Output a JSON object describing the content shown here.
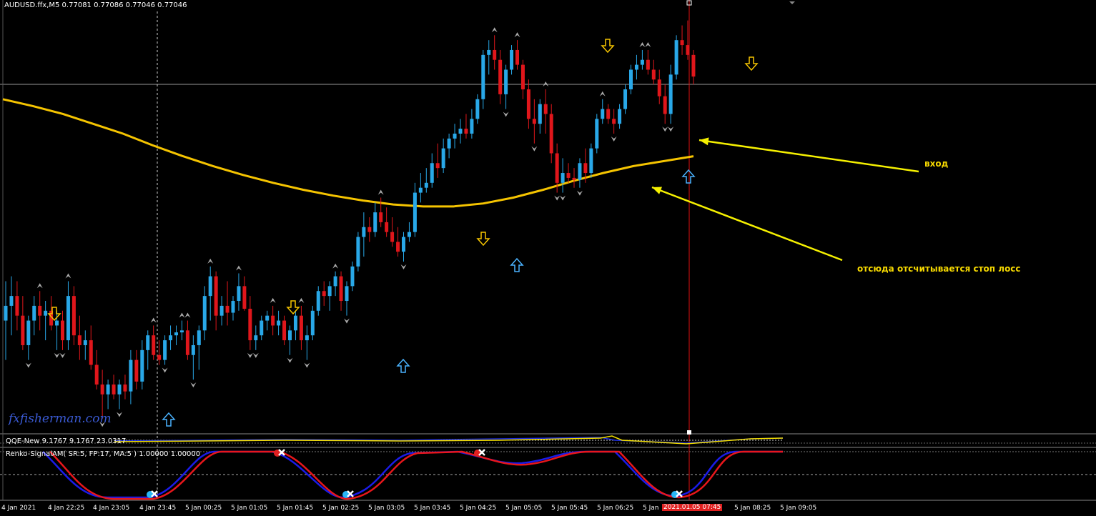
{
  "header": {
    "symbol_line": "AUDUSD.ffx,M5  0.77081 0.77086 0.77046 0.77046"
  },
  "indicators": {
    "qqe_label": "QQE-New 9.1767 9.1767 23.0317",
    "renko_label": "Renko-SignalAM( SR:5, FP:17, MA:5 ) 1.00000 1.00000"
  },
  "watermark": "fxfisherman.com",
  "annotations": {
    "entry": "вход",
    "stop_loss": "отсюда отсчитывается стоп лосс"
  },
  "colors": {
    "bull": "#29a8e8",
    "bear": "#e0161b",
    "ma": "#f5c400",
    "arrow_up": "#4ab3ff",
    "arrow_down": "#f5c400",
    "annotation": "#f5f000",
    "renko_blue": "#1b1be8",
    "renko_red": "#e8161b",
    "crosshair": "#e01010"
  },
  "time_axis": {
    "ticks": [
      "4 Jan 2021",
      "4 Jan 22:25",
      "4 Jan 23:05",
      "4 Jan 23:45",
      "5 Jan 00:25",
      "5 Jan 01:05",
      "5 Jan 01:45",
      "5 Jan 02:25",
      "5 Jan 03:05",
      "5 Jan 03:45",
      "5 Jan 04:25",
      "5 Jan 05:05",
      "5 Jan 05:45",
      "5 Jan 06:25",
      "5 Jan",
      "5 Jan 08:25",
      "5 Jan 09:05"
    ],
    "cursor_label": "2021.01.05 07:45"
  },
  "chart_data": {
    "type": "candlestick",
    "symbol": "AUDUSD.ffx",
    "timeframe": "M5",
    "candles": [
      {
        "o": 0.7695,
        "h": 0.7699,
        "l": 0.7691,
        "c": 0.76965
      },
      {
        "o": 0.76965,
        "h": 0.76995,
        "l": 0.76935,
        "c": 0.76975
      },
      {
        "o": 0.76975,
        "h": 0.7699,
        "l": 0.7694,
        "c": 0.76955
      },
      {
        "o": 0.76955,
        "h": 0.76975,
        "l": 0.7692,
        "c": 0.76925
      },
      {
        "o": 0.76925,
        "h": 0.76955,
        "l": 0.7691,
        "c": 0.7695
      },
      {
        "o": 0.7695,
        "h": 0.76975,
        "l": 0.76935,
        "c": 0.76965
      },
      {
        "o": 0.76965,
        "h": 0.7698,
        "l": 0.7694,
        "c": 0.76955
      },
      {
        "o": 0.76955,
        "h": 0.7697,
        "l": 0.7693,
        "c": 0.7696
      },
      {
        "o": 0.7696,
        "h": 0.76975,
        "l": 0.7694,
        "c": 0.76945
      },
      {
        "o": 0.76945,
        "h": 0.7696,
        "l": 0.7692,
        "c": 0.7695
      },
      {
        "o": 0.7695,
        "h": 0.7696,
        "l": 0.7692,
        "c": 0.7693
      },
      {
        "o": 0.7693,
        "h": 0.7699,
        "l": 0.7692,
        "c": 0.76975
      },
      {
        "o": 0.76975,
        "h": 0.76985,
        "l": 0.76925,
        "c": 0.76935
      },
      {
        "o": 0.76935,
        "h": 0.76955,
        "l": 0.7691,
        "c": 0.76925
      },
      {
        "o": 0.76925,
        "h": 0.7694,
        "l": 0.7691,
        "c": 0.7693
      },
      {
        "o": 0.7693,
        "h": 0.76945,
        "l": 0.769,
        "c": 0.76905
      },
      {
        "o": 0.76905,
        "h": 0.7692,
        "l": 0.7688,
        "c": 0.76885
      },
      {
        "o": 0.76885,
        "h": 0.769,
        "l": 0.7685,
        "c": 0.76875
      },
      {
        "o": 0.76875,
        "h": 0.7689,
        "l": 0.7686,
        "c": 0.76885
      },
      {
        "o": 0.76885,
        "h": 0.76895,
        "l": 0.7687,
        "c": 0.76875
      },
      {
        "o": 0.76875,
        "h": 0.7689,
        "l": 0.7686,
        "c": 0.76885
      },
      {
        "o": 0.76885,
        "h": 0.76895,
        "l": 0.7687,
        "c": 0.76878
      },
      {
        "o": 0.76878,
        "h": 0.7692,
        "l": 0.76865,
        "c": 0.7691
      },
      {
        "o": 0.7691,
        "h": 0.7692,
        "l": 0.7688,
        "c": 0.76888
      },
      {
        "o": 0.76888,
        "h": 0.7693,
        "l": 0.7688,
        "c": 0.7692
      },
      {
        "o": 0.7692,
        "h": 0.7694,
        "l": 0.769,
        "c": 0.76935
      },
      {
        "o": 0.76935,
        "h": 0.76945,
        "l": 0.7691,
        "c": 0.76915
      },
      {
        "o": 0.76915,
        "h": 0.7693,
        "l": 0.76905,
        "c": 0.7691
      },
      {
        "o": 0.7691,
        "h": 0.76935,
        "l": 0.76905,
        "c": 0.7693
      },
      {
        "o": 0.7693,
        "h": 0.76945,
        "l": 0.7692,
        "c": 0.76935
      },
      {
        "o": 0.76935,
        "h": 0.76945,
        "l": 0.76925,
        "c": 0.76938
      },
      {
        "o": 0.76938,
        "h": 0.7695,
        "l": 0.7693,
        "c": 0.7694
      },
      {
        "o": 0.7694,
        "h": 0.7695,
        "l": 0.7691,
        "c": 0.76915
      },
      {
        "o": 0.76915,
        "h": 0.76935,
        "l": 0.7689,
        "c": 0.76925
      },
      {
        "o": 0.76925,
        "h": 0.76945,
        "l": 0.769,
        "c": 0.7694
      },
      {
        "o": 0.7694,
        "h": 0.76985,
        "l": 0.7693,
        "c": 0.76975
      },
      {
        "o": 0.76975,
        "h": 0.77005,
        "l": 0.7695,
        "c": 0.76995
      },
      {
        "o": 0.76995,
        "h": 0.77,
        "l": 0.7694,
        "c": 0.76955
      },
      {
        "o": 0.76955,
        "h": 0.76975,
        "l": 0.76945,
        "c": 0.76965
      },
      {
        "o": 0.76965,
        "h": 0.7699,
        "l": 0.76945,
        "c": 0.76958
      },
      {
        "o": 0.76958,
        "h": 0.76975,
        "l": 0.7695,
        "c": 0.7697
      },
      {
        "o": 0.7697,
        "h": 0.76998,
        "l": 0.7696,
        "c": 0.76985
      },
      {
        "o": 0.76985,
        "h": 0.76995,
        "l": 0.7696,
        "c": 0.76962
      },
      {
        "o": 0.76962,
        "h": 0.76975,
        "l": 0.7692,
        "c": 0.7693
      },
      {
        "o": 0.7693,
        "h": 0.76945,
        "l": 0.7692,
        "c": 0.76935
      },
      {
        "o": 0.76935,
        "h": 0.76955,
        "l": 0.7693,
        "c": 0.7695
      },
      {
        "o": 0.7695,
        "h": 0.7696,
        "l": 0.7694,
        "c": 0.76955
      },
      {
        "o": 0.76955,
        "h": 0.76965,
        "l": 0.76935,
        "c": 0.76945
      },
      {
        "o": 0.76945,
        "h": 0.7696,
        "l": 0.76935,
        "c": 0.7695
      },
      {
        "o": 0.7695,
        "h": 0.76955,
        "l": 0.76925,
        "c": 0.7693
      },
      {
        "o": 0.7693,
        "h": 0.76945,
        "l": 0.76915,
        "c": 0.7694
      },
      {
        "o": 0.7694,
        "h": 0.7696,
        "l": 0.7693,
        "c": 0.76955
      },
      {
        "o": 0.76955,
        "h": 0.76965,
        "l": 0.7692,
        "c": 0.7693
      },
      {
        "o": 0.7693,
        "h": 0.76945,
        "l": 0.7691,
        "c": 0.76935
      },
      {
        "o": 0.76935,
        "h": 0.76965,
        "l": 0.7693,
        "c": 0.7696
      },
      {
        "o": 0.7696,
        "h": 0.76985,
        "l": 0.76955,
        "c": 0.7698
      },
      {
        "o": 0.7698,
        "h": 0.7699,
        "l": 0.76965,
        "c": 0.76975
      },
      {
        "o": 0.76975,
        "h": 0.7699,
        "l": 0.7696,
        "c": 0.76985
      },
      {
        "o": 0.76985,
        "h": 0.77,
        "l": 0.76975,
        "c": 0.76995
      },
      {
        "o": 0.76995,
        "h": 0.77,
        "l": 0.7696,
        "c": 0.7697
      },
      {
        "o": 0.7697,
        "h": 0.7699,
        "l": 0.76955,
        "c": 0.76985
      },
      {
        "o": 0.76985,
        "h": 0.7701,
        "l": 0.7698,
        "c": 0.77005
      },
      {
        "o": 0.77005,
        "h": 0.7704,
        "l": 0.77,
        "c": 0.77035
      },
      {
        "o": 0.77035,
        "h": 0.7706,
        "l": 0.77015,
        "c": 0.77045
      },
      {
        "o": 0.77045,
        "h": 0.77055,
        "l": 0.7703,
        "c": 0.7704
      },
      {
        "o": 0.7704,
        "h": 0.7707,
        "l": 0.77035,
        "c": 0.7706
      },
      {
        "o": 0.7706,
        "h": 0.77075,
        "l": 0.77045,
        "c": 0.7705
      },
      {
        "o": 0.7705,
        "h": 0.77065,
        "l": 0.77035,
        "c": 0.7704
      },
      {
        "o": 0.7704,
        "h": 0.77055,
        "l": 0.77025,
        "c": 0.7703
      },
      {
        "o": 0.7703,
        "h": 0.77045,
        "l": 0.77015,
        "c": 0.7702
      },
      {
        "o": 0.7702,
        "h": 0.7704,
        "l": 0.7701,
        "c": 0.77035
      },
      {
        "o": 0.77035,
        "h": 0.7705,
        "l": 0.7703,
        "c": 0.7704
      },
      {
        "o": 0.7704,
        "h": 0.7709,
        "l": 0.77035,
        "c": 0.7708
      },
      {
        "o": 0.7708,
        "h": 0.771,
        "l": 0.7707,
        "c": 0.77085
      },
      {
        "o": 0.77085,
        "h": 0.77105,
        "l": 0.7708,
        "c": 0.7709
      },
      {
        "o": 0.7709,
        "h": 0.7712,
        "l": 0.77085,
        "c": 0.7711
      },
      {
        "o": 0.7711,
        "h": 0.7713,
        "l": 0.77095,
        "c": 0.77105
      },
      {
        "o": 0.77105,
        "h": 0.77135,
        "l": 0.771,
        "c": 0.77125
      },
      {
        "o": 0.77125,
        "h": 0.7714,
        "l": 0.77115,
        "c": 0.77135
      },
      {
        "o": 0.77135,
        "h": 0.7715,
        "l": 0.77125,
        "c": 0.7714
      },
      {
        "o": 0.7714,
        "h": 0.77155,
        "l": 0.7713,
        "c": 0.77145
      },
      {
        "o": 0.77145,
        "h": 0.7716,
        "l": 0.77135,
        "c": 0.7714
      },
      {
        "o": 0.7714,
        "h": 0.77165,
        "l": 0.77135,
        "c": 0.77155
      },
      {
        "o": 0.77155,
        "h": 0.7718,
        "l": 0.7715,
        "c": 0.77175
      },
      {
        "o": 0.77175,
        "h": 0.77225,
        "l": 0.77165,
        "c": 0.7722
      },
      {
        "o": 0.7722,
        "h": 0.77235,
        "l": 0.772,
        "c": 0.77225
      },
      {
        "o": 0.77225,
        "h": 0.7724,
        "l": 0.77205,
        "c": 0.77215
      },
      {
        "o": 0.77215,
        "h": 0.77225,
        "l": 0.7717,
        "c": 0.7718
      },
      {
        "o": 0.7718,
        "h": 0.7721,
        "l": 0.77165,
        "c": 0.77205
      },
      {
        "o": 0.77205,
        "h": 0.7723,
        "l": 0.772,
        "c": 0.77225
      },
      {
        "o": 0.77225,
        "h": 0.77235,
        "l": 0.77205,
        "c": 0.7721
      },
      {
        "o": 0.7721,
        "h": 0.77215,
        "l": 0.77175,
        "c": 0.77185
      },
      {
        "o": 0.77185,
        "h": 0.77195,
        "l": 0.77145,
        "c": 0.77155
      },
      {
        "o": 0.77155,
        "h": 0.77175,
        "l": 0.7713,
        "c": 0.7715
      },
      {
        "o": 0.7715,
        "h": 0.77175,
        "l": 0.7714,
        "c": 0.7717
      },
      {
        "o": 0.7717,
        "h": 0.77185,
        "l": 0.7714,
        "c": 0.7716
      },
      {
        "o": 0.7716,
        "h": 0.7717,
        "l": 0.7711,
        "c": 0.7712
      },
      {
        "o": 0.7712,
        "h": 0.7713,
        "l": 0.7708,
        "c": 0.7709
      },
      {
        "o": 0.7709,
        "h": 0.77115,
        "l": 0.7708,
        "c": 0.771
      },
      {
        "o": 0.771,
        "h": 0.7711,
        "l": 0.7709,
        "c": 0.77095
      },
      {
        "o": 0.77095,
        "h": 0.77105,
        "l": 0.77085,
        "c": 0.77093
      },
      {
        "o": 0.77093,
        "h": 0.77115,
        "l": 0.77085,
        "c": 0.7711
      },
      {
        "o": 0.7711,
        "h": 0.77125,
        "l": 0.7709,
        "c": 0.771
      },
      {
        "o": 0.771,
        "h": 0.7713,
        "l": 0.77095,
        "c": 0.77125
      },
      {
        "o": 0.77125,
        "h": 0.7716,
        "l": 0.7712,
        "c": 0.77155
      },
      {
        "o": 0.77155,
        "h": 0.77175,
        "l": 0.7715,
        "c": 0.77165
      },
      {
        "o": 0.77165,
        "h": 0.7717,
        "l": 0.7715,
        "c": 0.77155
      },
      {
        "o": 0.77155,
        "h": 0.77165,
        "l": 0.7714,
        "c": 0.7715
      },
      {
        "o": 0.7715,
        "h": 0.7717,
        "l": 0.77145,
        "c": 0.77165
      },
      {
        "o": 0.77165,
        "h": 0.7719,
        "l": 0.7716,
        "c": 0.77185
      },
      {
        "o": 0.77185,
        "h": 0.7721,
        "l": 0.7718,
        "c": 0.77205
      },
      {
        "o": 0.77205,
        "h": 0.7722,
        "l": 0.77195,
        "c": 0.7721
      },
      {
        "o": 0.7721,
        "h": 0.77225,
        "l": 0.77205,
        "c": 0.77215
      },
      {
        "o": 0.77215,
        "h": 0.77225,
        "l": 0.772,
        "c": 0.77205
      },
      {
        "o": 0.77205,
        "h": 0.77215,
        "l": 0.7719,
        "c": 0.77195
      },
      {
        "o": 0.77195,
        "h": 0.77205,
        "l": 0.7717,
        "c": 0.77178
      },
      {
        "o": 0.77178,
        "h": 0.7719,
        "l": 0.7715,
        "c": 0.7716
      },
      {
        "o": 0.7716,
        "h": 0.7721,
        "l": 0.7715,
        "c": 0.772
      },
      {
        "o": 0.772,
        "h": 0.7724,
        "l": 0.77195,
        "c": 0.77235
      },
      {
        "o": 0.77235,
        "h": 0.7725,
        "l": 0.7722,
        "c": 0.7723
      },
      {
        "o": 0.7723,
        "h": 0.77255,
        "l": 0.77215,
        "c": 0.7722
      },
      {
        "o": 0.7722,
        "h": 0.77225,
        "l": 0.7719,
        "c": 0.77198
      }
    ],
    "ma_line": [
      0.77175,
      0.77168,
      0.7716,
      0.7715,
      0.7714,
      0.77128,
      0.77117,
      0.77107,
      0.77098,
      0.7709,
      0.77083,
      0.77077,
      0.77072,
      0.77068,
      0.77066,
      0.77066,
      0.77069,
      0.77075,
      0.77083,
      0.77092,
      0.771,
      0.77107,
      0.77112,
      0.77117
    ],
    "annotations": [
      {
        "text": "вход",
        "target_index": 112
      },
      {
        "text": "отсюда отсчитывается стоп лосс",
        "target_index": 103
      }
    ]
  }
}
